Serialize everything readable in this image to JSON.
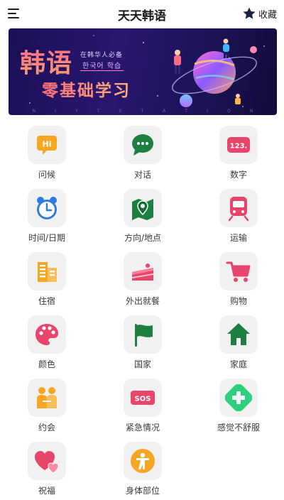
{
  "header": {
    "title": "天天韩语",
    "favorite_label": "收藏"
  },
  "banner": {
    "headline": "韩语",
    "tagline_cn": "在韩华人必备",
    "tagline_kr": "한국어 학습",
    "subheadline": "零基础学习",
    "footer_letters": [
      "N",
      "I",
      "Y",
      "T",
      "S",
      "T",
      "A",
      "T",
      "I",
      "O",
      "N"
    ]
  },
  "categories": [
    {
      "label": "问候",
      "icon": "hi-bubble-icon"
    },
    {
      "label": "对话",
      "icon": "chat-bubble-icon"
    },
    {
      "label": "数字",
      "icon": "numbers-icon"
    },
    {
      "label": "时间/日期",
      "icon": "alarm-clock-icon"
    },
    {
      "label": "方向/地点",
      "icon": "map-pin-icon"
    },
    {
      "label": "运输",
      "icon": "train-icon"
    },
    {
      "label": "住宿",
      "icon": "buildings-icon"
    },
    {
      "label": "外出就餐",
      "icon": "cake-icon"
    },
    {
      "label": "购物",
      "icon": "shopping-cart-icon"
    },
    {
      "label": "颜色",
      "icon": "palette-icon"
    },
    {
      "label": "国家",
      "icon": "flag-icon"
    },
    {
      "label": "家庭",
      "icon": "home-icon"
    },
    {
      "label": "约会",
      "icon": "couple-icon"
    },
    {
      "label": "紧急情况",
      "icon": "sos-icon"
    },
    {
      "label": "感觉不舒服",
      "icon": "medical-cross-icon"
    },
    {
      "label": "祝福",
      "icon": "hearts-icon"
    },
    {
      "label": "身体部位",
      "icon": "person-icon"
    }
  ]
}
